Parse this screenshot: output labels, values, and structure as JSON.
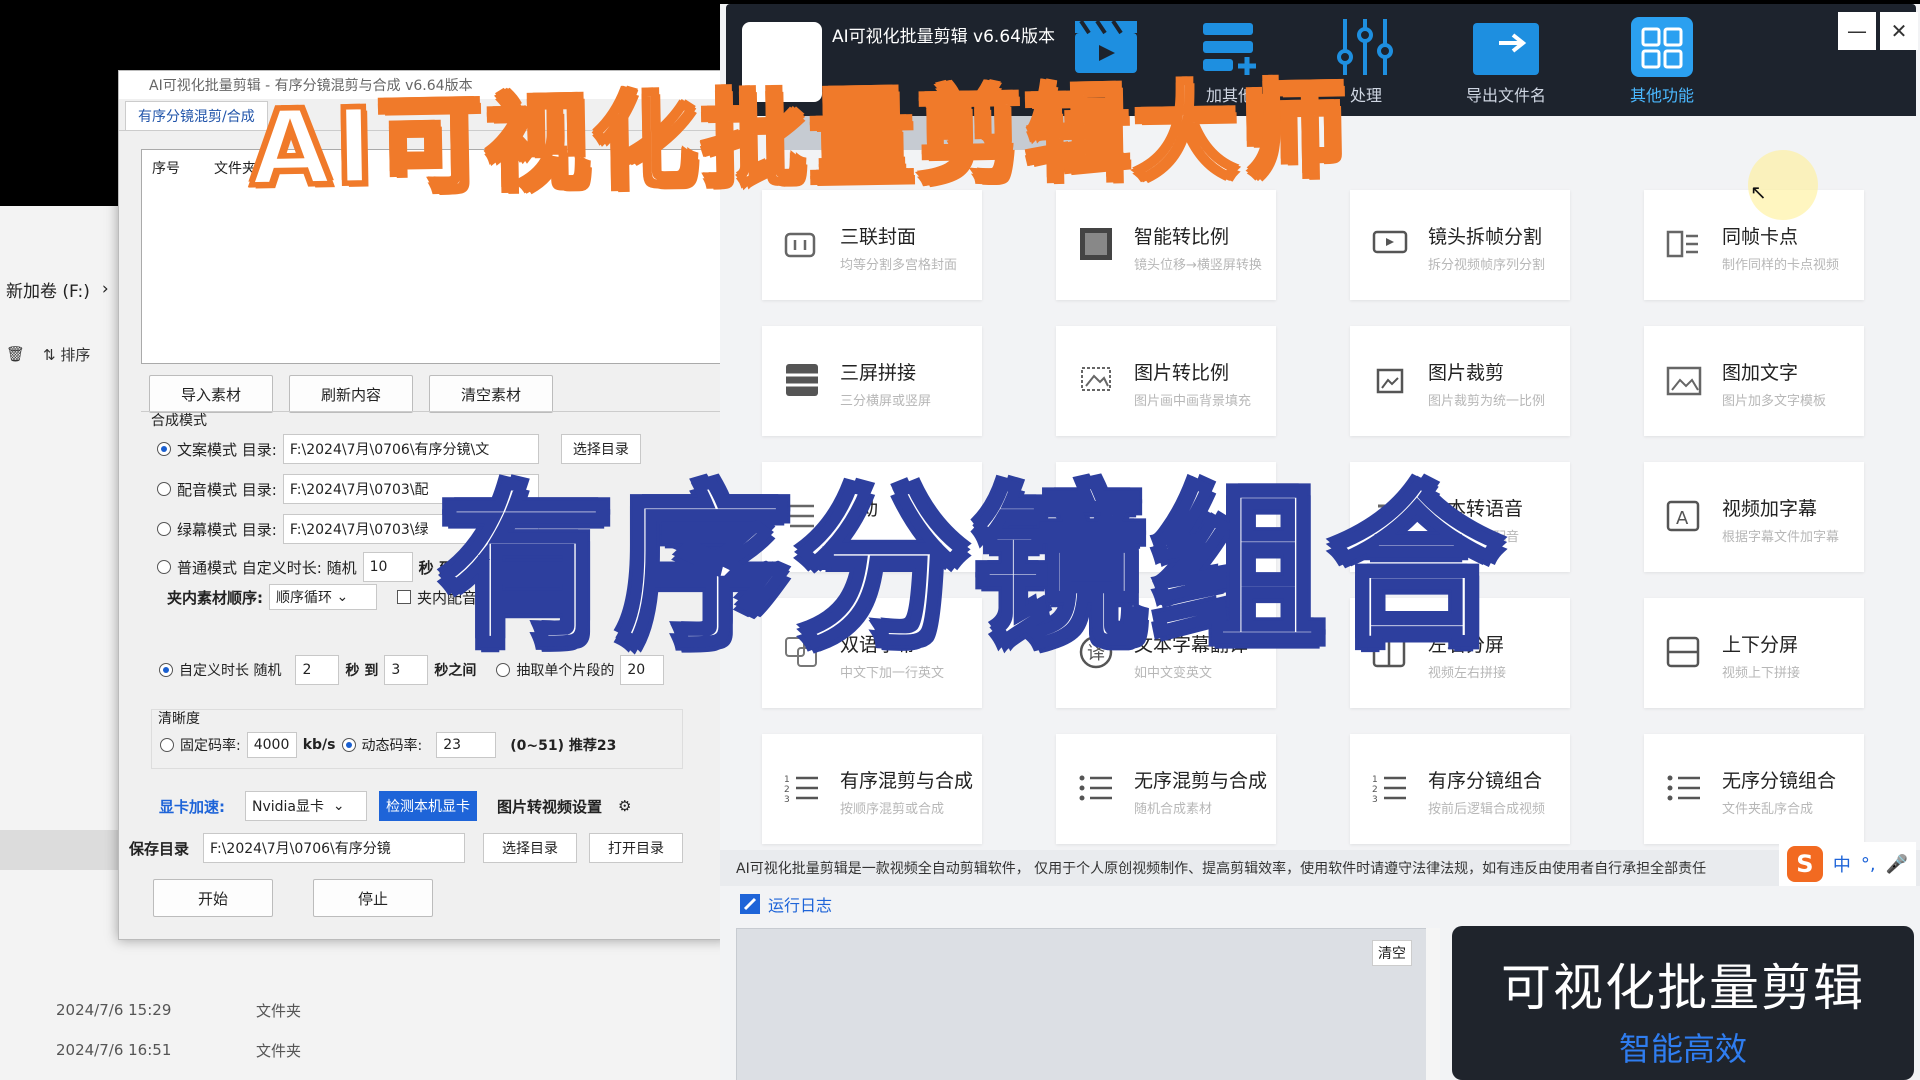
{
  "explorer": {
    "drive_label": "新加卷 (F:)",
    "sort_label": "排序",
    "rows": [
      {
        "date": "2024/7/6 15:29",
        "type": "文件夹"
      },
      {
        "date": "2024/7/6 16:51",
        "type": "文件夹"
      }
    ]
  },
  "left_window": {
    "title": "AI可视化批量剪辑 - 有序分镜混剪与合成 v6.64版本",
    "tab_active": "有序分镜混剪/合成",
    "grid_headers": [
      "序号",
      "文件夹"
    ],
    "buttons": {
      "import": "导入素材",
      "refresh": "刷新内容",
      "clear": "清空素材"
    },
    "mode_legend": "合成模式",
    "modes": [
      {
        "label": "文案模式 目录:",
        "path": "F:\\2024\\7月\\0706\\有序分镜\\文",
        "checked": true
      },
      {
        "label": "配音模式 目录:",
        "path": "F:\\2024\\7月\\0703\\配",
        "checked": false
      },
      {
        "label": "绿幕模式 目录:",
        "path": "F:\\2024\\7月\\0703\\绿",
        "checked": false
      },
      {
        "label": "普通模式 自定义时长: 随机",
        "path": "10",
        "checked": false
      }
    ],
    "choose_dir": "选择目录",
    "seconds_label": "秒 到",
    "order_label": "夹内素材顺序:",
    "order_value": "顺序循环",
    "clip_check_label": "夹内配音",
    "custom_duration": {
      "label": "自定义时长 随机",
      "min": "2",
      "to": "秒 到",
      "max": "3",
      "between": "秒之间"
    },
    "extract_label": "抽取单个片段的",
    "extract_value": "20",
    "quality": {
      "legend": "清晰度",
      "fixed_label": "固定码率:",
      "fixed_value": "4000",
      "unit": "kb/s",
      "dynamic_label": "动态码率:",
      "dynamic_value": "23",
      "range_hint": "(0~51) 推荐23"
    },
    "gpu": {
      "label": "显卡加速:",
      "value": "Nvidia显卡",
      "detect": "检测本机显卡",
      "img2video": "图片转视频设置"
    },
    "save": {
      "label": "保存目录",
      "path": "F:\\2024\\7月\\0706\\有序分镜",
      "choose": "选择目录",
      "open": "打开目录"
    },
    "start": "开始",
    "stop": "停止"
  },
  "right_window": {
    "title": "AI可视化批量剪辑 v6.64版本",
    "nav": [
      {
        "label": "",
        "icon": "clapperboard-icon"
      },
      {
        "label": "加其他",
        "icon": "add-list-icon"
      },
      {
        "label": "处理",
        "icon": "sliders-icon"
      },
      {
        "label": "导出文件名",
        "icon": "export-icon"
      },
      {
        "label": "其他功能",
        "icon": "grid-icon"
      }
    ],
    "window_controls": {
      "minimize": "—",
      "close": "✕"
    },
    "cards": [
      {
        "title": "三联封面",
        "sub": "均等分割多宫格封面",
        "icon": "triptych-icon"
      },
      {
        "title": "智能转比例",
        "sub": "镜头位移→横竖屏转换",
        "icon": "ratio-icon"
      },
      {
        "title": "镜头拆帧分割",
        "sub": "拆分视频帧序列分割",
        "icon": "film-split-icon"
      },
      {
        "title": "同帧卡点",
        "sub": "制作同样的卡点视频",
        "icon": "beat-sync-icon"
      },
      {
        "title": "三屏拼接",
        "sub": "三分横屏或竖屏",
        "icon": "three-screen-icon"
      },
      {
        "title": "图片转比例",
        "sub": "图片画中画背景填充",
        "icon": "image-ratio-icon"
      },
      {
        "title": "图片裁剪",
        "sub": "图片裁剪为统一比例",
        "icon": "image-crop-icon"
      },
      {
        "title": "图加文字",
        "sub": "图片加多文字模板",
        "icon": "image-text-icon"
      },
      {
        "title": "滚动",
        "sub": "",
        "icon": "scroll-icon"
      },
      {
        "title": "",
        "sub": "",
        "icon": "blank-icon"
      },
      {
        "title": "文本转语音",
        "sub": "批量把文字配音",
        "icon": "tts-icon"
      },
      {
        "title": "视频加字幕",
        "sub": "根据字幕文件加字幕",
        "icon": "subtitle-add-icon"
      },
      {
        "title": "双语字幕",
        "sub": "中文下加一行英文",
        "icon": "bilingual-icon"
      },
      {
        "title": "文本字幕翻译",
        "sub": "如中文变英文",
        "icon": "translate-icon"
      },
      {
        "title": "左右分屏",
        "sub": "视频左右拼接",
        "icon": "split-lr-icon"
      },
      {
        "title": "上下分屏",
        "sub": "视频上下拼接",
        "icon": "split-tb-icon"
      },
      {
        "title": "有序混剪与合成",
        "sub": "按顺序混剪或合成",
        "icon": "ordered-list-icon"
      },
      {
        "title": "无序混剪与合成",
        "sub": "随机合成素材",
        "icon": "unordered-list-icon"
      },
      {
        "title": "有序分镜组合",
        "sub": "按前后逻辑合成视频",
        "icon": "ordered-list-icon"
      },
      {
        "title": "无序分镜组合",
        "sub": "文件夹乱序合成",
        "icon": "unordered-list-icon"
      }
    ],
    "disclaimer": "AI可视化批量剪辑是一款视频全自动剪辑软件， 仅用于个人原创视频制作、提高剪辑效率，使用软件时请遵守法律法规，如有违反由使用者自行承担全部责任",
    "ime": {
      "logo": "S",
      "lang": "中",
      "punct": "°,",
      "mic": "🎤"
    },
    "log_label": "运行日志",
    "clear_label": "清空",
    "promo_line1": "可视化批量剪辑",
    "promo_line2": "智能高效"
  },
  "overlay": {
    "banner": "AI可视化批量剪辑大师",
    "headline": "有序分镜组合"
  },
  "colors": {
    "accent_blue": "#1e64d8",
    "banner_orange": "#f07a2a",
    "headline_navy": "#2d3f9e",
    "header_dark": "#1d232d"
  }
}
